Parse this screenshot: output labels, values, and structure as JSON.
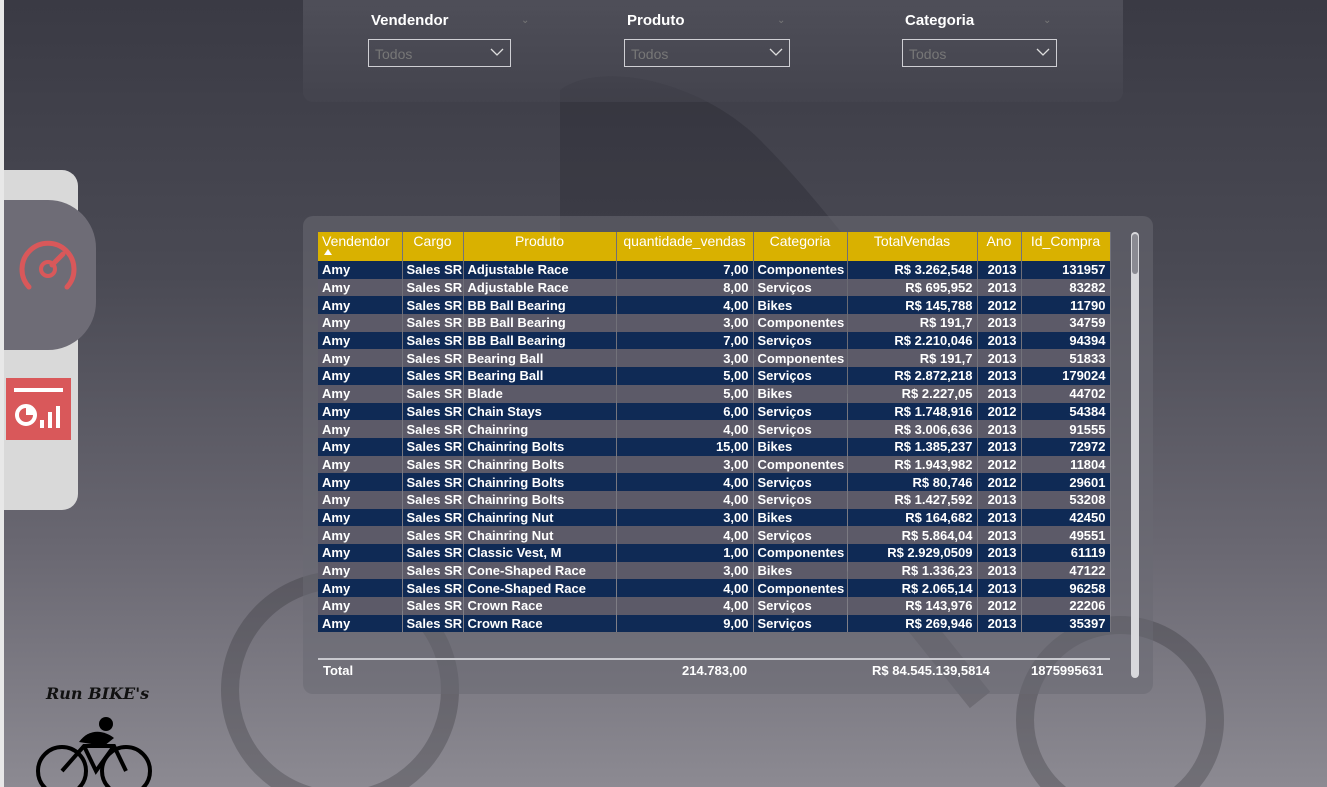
{
  "filters": [
    {
      "label": "Vendendor",
      "value": "Todos"
    },
    {
      "label": "Produto",
      "value": "Todos"
    },
    {
      "label": "Categoria",
      "value": "Todos"
    }
  ],
  "brand": {
    "title": "Run BIKE's"
  },
  "nav": {
    "items": [
      {
        "icon": "gauge-icon",
        "active": true
      },
      {
        "icon": "report-chart-icon",
        "active": false
      }
    ]
  },
  "table": {
    "columns": [
      "Vendendor",
      "Cargo",
      "Produto",
      "quantidade_vendas",
      "Categoria",
      "TotalVendas",
      "Ano",
      "Id_Compra"
    ],
    "sorted_column": "Vendendor",
    "rows": [
      [
        "Amy",
        "Sales SR",
        "Adjustable Race",
        "7,00",
        "Componentes",
        "R$ 3.262,548",
        "2013",
        "131957"
      ],
      [
        "Amy",
        "Sales SR",
        "Adjustable Race",
        "8,00",
        "Serviços",
        "R$ 695,952",
        "2013",
        "83282"
      ],
      [
        "Amy",
        "Sales SR",
        "BB Ball Bearing",
        "4,00",
        "Bikes",
        "R$ 145,788",
        "2012",
        "11790"
      ],
      [
        "Amy",
        "Sales SR",
        "BB Ball Bearing",
        "3,00",
        "Componentes",
        "R$ 191,7",
        "2013",
        "34759"
      ],
      [
        "Amy",
        "Sales SR",
        "BB Ball Bearing",
        "7,00",
        "Serviços",
        "R$ 2.210,046",
        "2013",
        "94394"
      ],
      [
        "Amy",
        "Sales SR",
        "Bearing Ball",
        "3,00",
        "Componentes",
        "R$ 191,7",
        "2013",
        "51833"
      ],
      [
        "Amy",
        "Sales SR",
        "Bearing Ball",
        "5,00",
        "Serviços",
        "R$ 2.872,218",
        "2013",
        "179024"
      ],
      [
        "Amy",
        "Sales SR",
        "Blade",
        "5,00",
        "Bikes",
        "R$ 2.227,05",
        "2013",
        "44702"
      ],
      [
        "Amy",
        "Sales SR",
        "Chain Stays",
        "6,00",
        "Serviços",
        "R$ 1.748,916",
        "2012",
        "54384"
      ],
      [
        "Amy",
        "Sales SR",
        "Chainring",
        "4,00",
        "Serviços",
        "R$ 3.006,636",
        "2013",
        "91555"
      ],
      [
        "Amy",
        "Sales SR",
        "Chainring Bolts",
        "15,00",
        "Bikes",
        "R$ 1.385,237",
        "2013",
        "72972"
      ],
      [
        "Amy",
        "Sales SR",
        "Chainring Bolts",
        "3,00",
        "Componentes",
        "R$ 1.943,982",
        "2012",
        "11804"
      ],
      [
        "Amy",
        "Sales SR",
        "Chainring Bolts",
        "4,00",
        "Serviços",
        "R$ 80,746",
        "2012",
        "29601"
      ],
      [
        "Amy",
        "Sales SR",
        "Chainring Bolts",
        "4,00",
        "Serviços",
        "R$ 1.427,592",
        "2013",
        "53208"
      ],
      [
        "Amy",
        "Sales SR",
        "Chainring Nut",
        "3,00",
        "Bikes",
        "R$ 164,682",
        "2013",
        "42450"
      ],
      [
        "Amy",
        "Sales SR",
        "Chainring Nut",
        "4,00",
        "Serviços",
        "R$ 5.864,04",
        "2013",
        "49551"
      ],
      [
        "Amy",
        "Sales SR",
        "Classic Vest, M",
        "1,00",
        "Componentes",
        "R$ 2.929,0509",
        "2013",
        "61119"
      ],
      [
        "Amy",
        "Sales SR",
        "Cone-Shaped Race",
        "3,00",
        "Bikes",
        "R$ 1.336,23",
        "2013",
        "47122"
      ],
      [
        "Amy",
        "Sales SR",
        "Cone-Shaped Race",
        "4,00",
        "Componentes",
        "R$ 2.065,14",
        "2013",
        "96258"
      ],
      [
        "Amy",
        "Sales SR",
        "Crown Race",
        "4,00",
        "Serviços",
        "R$ 143,976",
        "2012",
        "22206"
      ],
      [
        "Amy",
        "Sales SR",
        "Crown Race",
        "9,00",
        "Serviços",
        "R$ 269,946",
        "2013",
        "35397"
      ]
    ],
    "total": {
      "label": "Total",
      "quantidade_vendas": "214.783,00",
      "TotalVendas": "R$ 84.545.139,5814",
      "Id_Compra": "1875995631"
    }
  },
  "colors": {
    "header_bg": "#d9b100",
    "row_dark": "#0f2a55",
    "row_light": "#5c5a68",
    "accent_red": "#d9585a"
  }
}
